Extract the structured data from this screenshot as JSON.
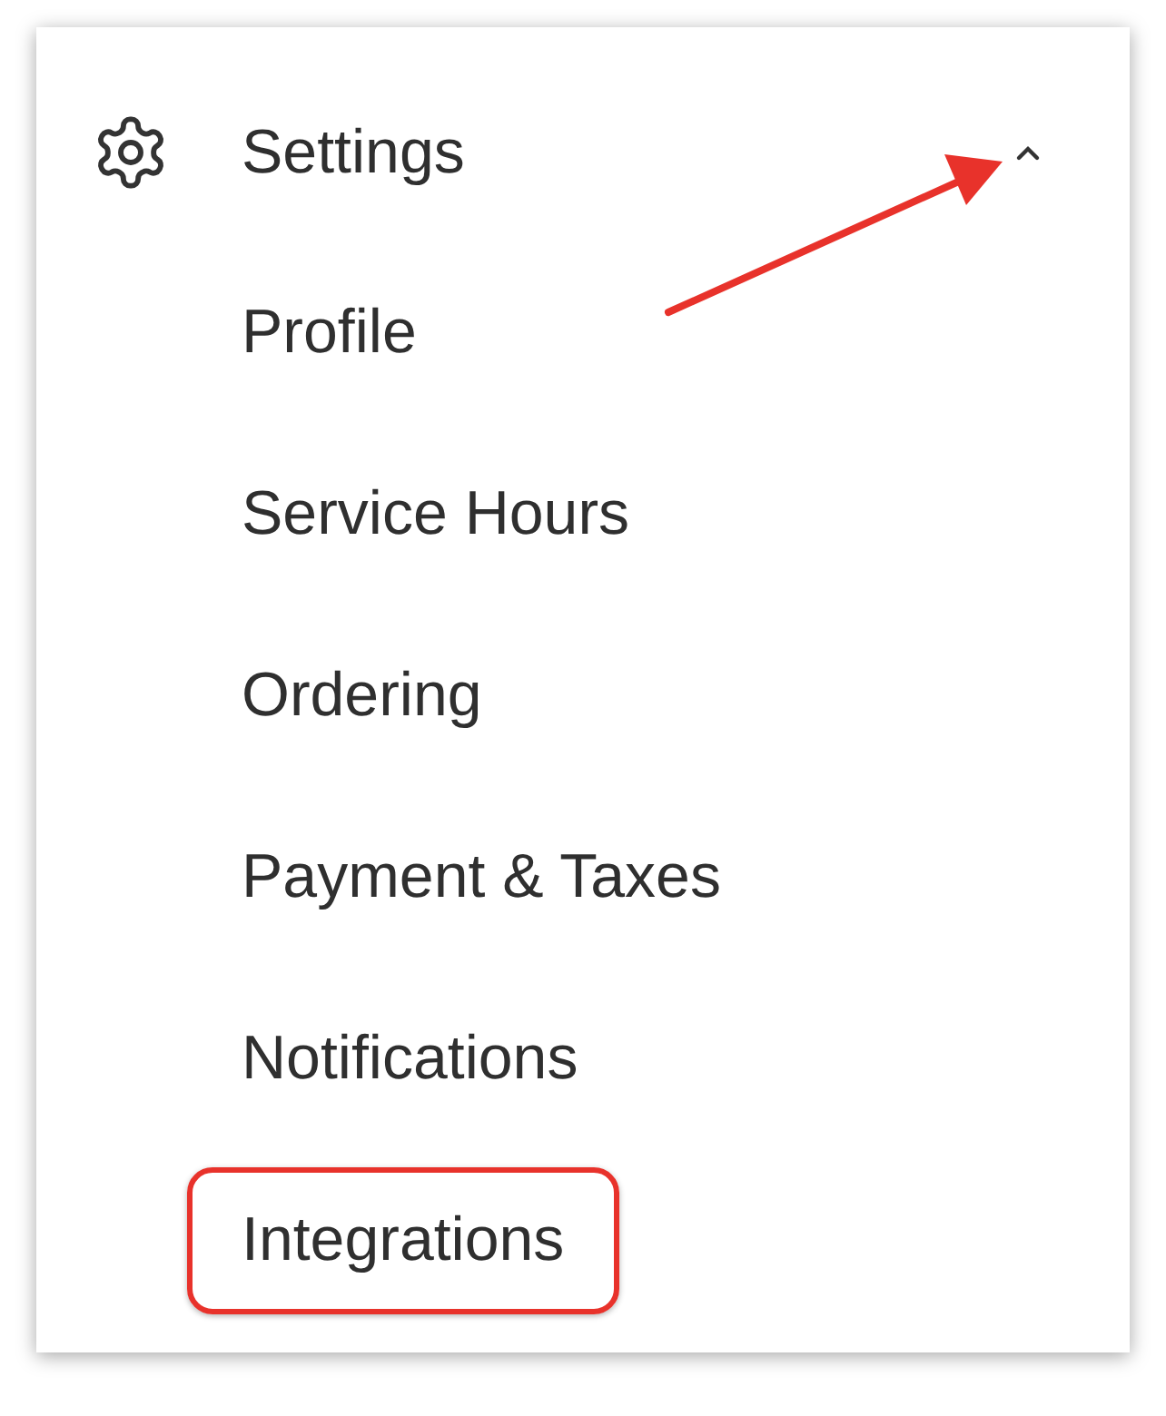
{
  "menu": {
    "title": "Settings",
    "expanded": true,
    "items": [
      {
        "label": "Profile",
        "outlined": false
      },
      {
        "label": "Service Hours",
        "outlined": false
      },
      {
        "label": "Ordering",
        "outlined": false
      },
      {
        "label": "Payment & Taxes",
        "outlined": false
      },
      {
        "label": "Notifications",
        "outlined": false
      },
      {
        "label": "Integrations",
        "outlined": true
      }
    ]
  },
  "annotation": {
    "arrow_to_chevron": true
  }
}
